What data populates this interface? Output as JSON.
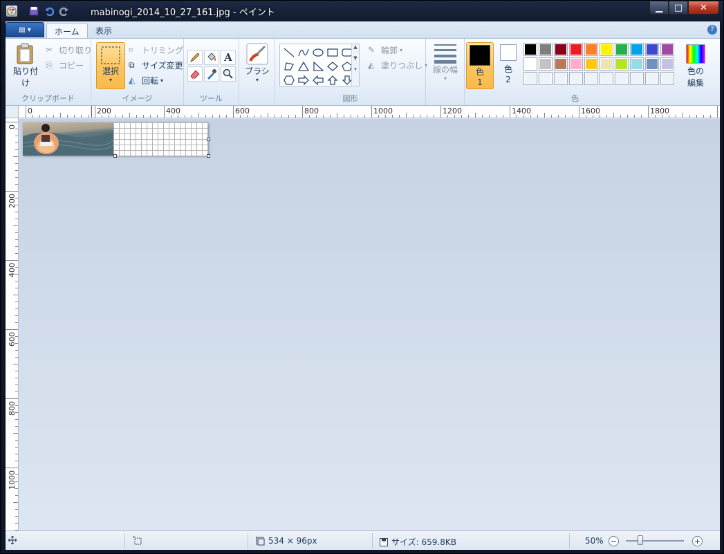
{
  "window": {
    "title": "mabinogi_2014_10_27_161.jpg - ペイント",
    "minimize": "▁",
    "maximize": "□",
    "close": "✕"
  },
  "tabs": {
    "home": "ホーム",
    "view": "表示",
    "help": "?"
  },
  "clipboard": {
    "paste": "貼り付け",
    "cut": "切り取り",
    "copy": "コピー",
    "label": "クリップボード"
  },
  "image": {
    "select": "選択",
    "crop": "トリミング",
    "resize": "サイズ変更",
    "rotate": "回転",
    "label": "イメージ"
  },
  "tools": {
    "label": "ツール"
  },
  "brushes": {
    "label": "ブラシ"
  },
  "shapes": {
    "outline": "輪郭",
    "fill": "塗りつぶし",
    "label": "図形"
  },
  "size": {
    "label": "線の幅"
  },
  "colors": {
    "color1": "色\n1",
    "color1_a": "色",
    "color1_b": "1",
    "color2_a": "色",
    "color2_b": "2",
    "edit_a": "色の",
    "edit_b": "編集",
    "label": "色",
    "color1_value": "#000000",
    "color2_value": "#ffffff",
    "palette": [
      "#000000",
      "#7f7f7f",
      "#880015",
      "#ed1c24",
      "#ff7f27",
      "#fff200",
      "#22b14c",
      "#00a2e8",
      "#3f48cc",
      "#a349a4",
      "#ffffff",
      "#c3c3c3",
      "#b97a57",
      "#ffaec9",
      "#ffc90e",
      "#efe4b0",
      "#b5e61d",
      "#99d9ea",
      "#7092be",
      "#c8bfe7",
      "#ffffff",
      "#ffffff",
      "#ffffff",
      "#ffffff",
      "#ffffff",
      "#ffffff",
      "#ffffff",
      "#ffffff",
      "#ffffff",
      "#ffffff"
    ]
  },
  "ruler": {
    "h_labels": [
      "0",
      "200",
      "400",
      "600",
      "800",
      "1000",
      "1200",
      "1400",
      "1600",
      "1800"
    ],
    "v_labels": [
      "0",
      "200",
      "400",
      "600",
      "800",
      "1000"
    ]
  },
  "status": {
    "dimensions": "534 × 96px",
    "file_size": "サイズ: 659.8KB",
    "zoom": "50%",
    "zoom_out": "−",
    "zoom_in": "+"
  }
}
